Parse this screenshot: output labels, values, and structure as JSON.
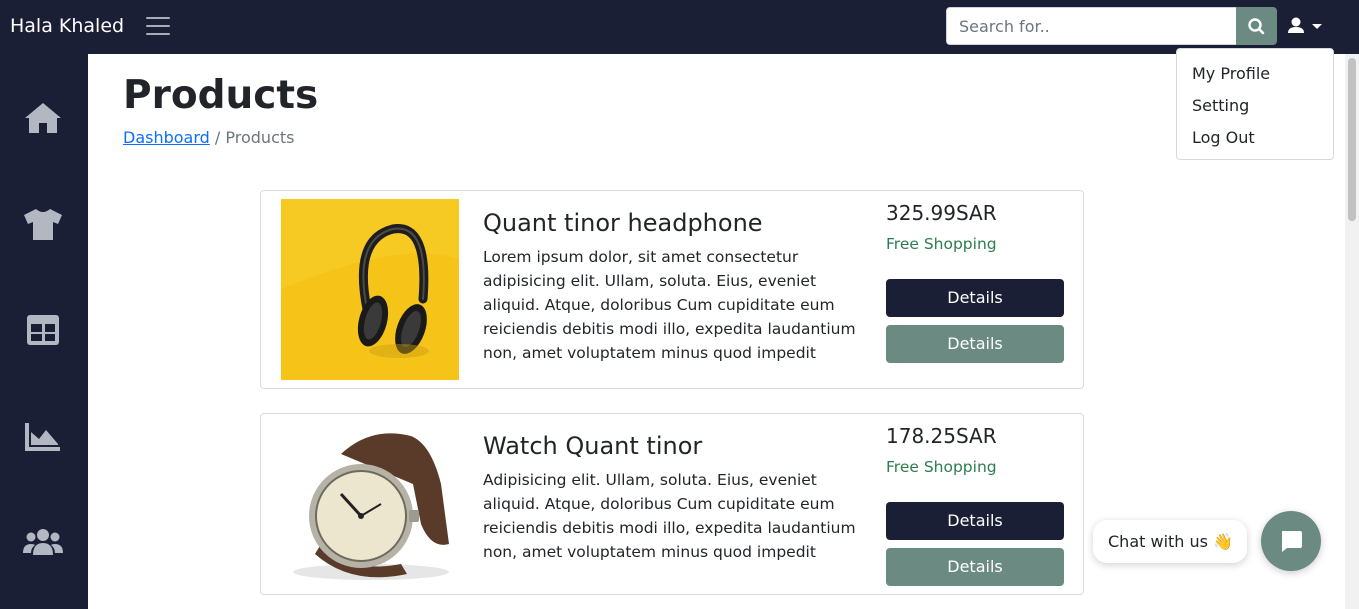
{
  "brand": "Hala Khaled",
  "search": {
    "placeholder": "Search for.."
  },
  "user_menu": {
    "items": [
      "My Profile",
      "Setting",
      "Log Out"
    ]
  },
  "sidebar": {
    "icons": [
      "home-icon",
      "tshirt-icon",
      "table-icon",
      "chart-area-icon",
      "users-icon"
    ]
  },
  "page": {
    "title": "Products"
  },
  "breadcrumb": {
    "link": "Dashboard",
    "separator": "/",
    "current": "Products"
  },
  "products": [
    {
      "name": "Quant tinor headphone",
      "description": "Lorem ipsum dolor, sit amet consectetur adipisicing elit. Ullam, soluta. Eius, eveniet aliquid. Atque, doloribus Cum cupiditate eum reiciendis debitis modi illo, expedita laudantium non, amet voluptatem minus quod impedit",
      "price": "325.99SAR",
      "shipping": "Free Shopping",
      "buttons": [
        "Details",
        "Details"
      ]
    },
    {
      "name": "Watch Quant tinor",
      "description": "Adipisicing elit. Ullam, soluta. Eius, eveniet aliquid. Atque, doloribus Cum cupiditate eum reiciendis debitis modi illo, expedita laudantium non, amet voluptatem minus quod impedit",
      "price": "178.25SAR",
      "shipping": "Free Shopping",
      "buttons": [
        "Details",
        "Details"
      ]
    }
  ],
  "chat": {
    "label": "Chat with us 👋"
  },
  "colors": {
    "navbar": "#1b1f36",
    "accent": "#6b8a82",
    "shipping_text": "#2e7d4f",
    "link": "#0d6efd"
  }
}
